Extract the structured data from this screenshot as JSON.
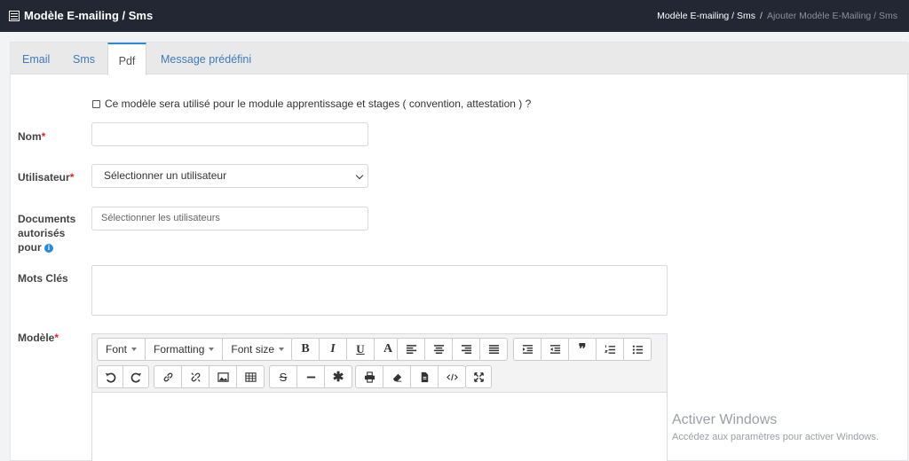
{
  "header": {
    "title": "Modèle E-mailing / Sms",
    "breadcrumb": [
      "Modèle E-mailing / Sms",
      "/",
      "Ajouter Modèle E-Mailing / Sms"
    ]
  },
  "tabs": [
    {
      "label": "Email",
      "active": false
    },
    {
      "label": "Sms",
      "active": false
    },
    {
      "label": "Pdf",
      "active": true
    },
    {
      "label": "Message prédéfini",
      "active": false
    }
  ],
  "form": {
    "checkbox_label": "Ce modèle sera utilisé pour le module apprentissage et stages ( convention, attestation ) ?",
    "checkbox_checked": false,
    "nom_label": "Nom",
    "nom_value": "",
    "utilisateur_label": "Utilisateur",
    "utilisateur_value": "Sélectionner un utilisateur",
    "documents_label": [
      "Documents",
      "autorisés",
      "pour"
    ],
    "documents_placeholder": "Sélectionner les utilisateurs",
    "mots_cles_label": "Mots Clés",
    "modele_label": "Modèle",
    "required_mark": "*"
  },
  "editor": {
    "dropdowns": [
      "Font",
      "Formatting",
      "Font size"
    ],
    "format_buttons": [
      "bold-icon",
      "italic-icon",
      "underline-icon",
      "font-color-icon"
    ],
    "align_buttons": [
      "align-left-icon",
      "align-center-icon",
      "align-right-icon",
      "justify-icon"
    ],
    "block_buttons": [
      "indent-icon",
      "outdent-icon",
      "blockquote-icon",
      "ordered-list-icon",
      "unordered-list-icon"
    ],
    "history_buttons": [
      "undo-icon",
      "redo-icon"
    ],
    "insert_buttons": [
      "link-icon",
      "unlink-icon",
      "image-icon",
      "table-icon"
    ],
    "misc_buttons": [
      "strikethrough-icon",
      "horizontal-rule-icon",
      "special-char-icon"
    ],
    "tool_buttons": [
      "print-icon",
      "eraser-icon",
      "document-icon",
      "code-icon"
    ],
    "fullscreen_button": "fullscreen-icon"
  },
  "watermark": {
    "title": "Activer Windows",
    "subtitle": "Accédez aux paramètres pour activer Windows."
  },
  "colors": {
    "header_bg": "#222733",
    "tab_link": "#3b7bbf",
    "active_tab_border": "#2a8bd9",
    "required": "#e02424"
  }
}
